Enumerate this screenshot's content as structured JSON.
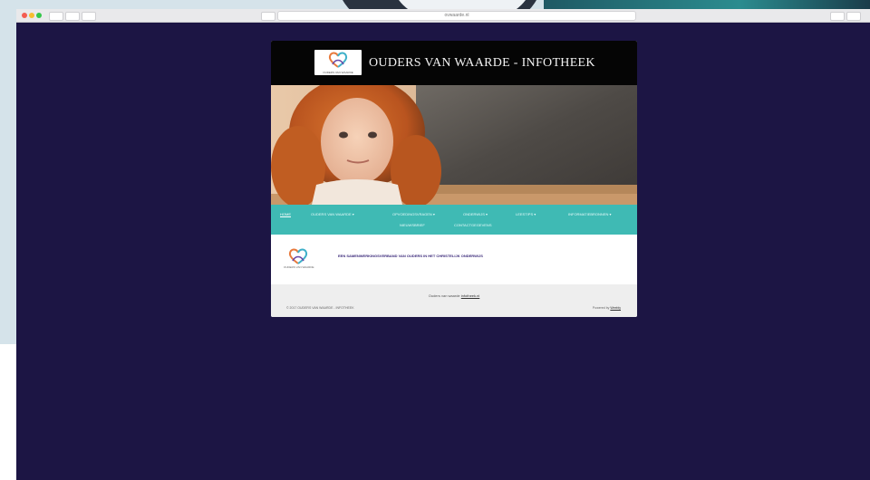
{
  "browser": {
    "url": "ovwaarde.nl"
  },
  "site": {
    "title": "OUDERS VAN WAARDE - INFOTHEEK",
    "logo_caption": "OUDERS VAN WAARDE",
    "nav": [
      {
        "label": "HOME",
        "active": true
      },
      {
        "label": "OUDERS VAN WAARDE ▾"
      },
      {
        "label": "OPVOEDINGSVRAGEN ▾"
      },
      {
        "label": "ONDERWIJS ▾"
      },
      {
        "label": "LEESTIPS ▾"
      },
      {
        "label": "INFORMATIEBRONNEN ▾"
      },
      {
        "label": "NIEUWSBRIEF"
      },
      {
        "label": "CONTACTGEGEVENS"
      }
    ],
    "content_text": "EEN SAMENWERKINGSVERBAND VAN OUDERS IN HET CHRISTELIJK ONDERWIJS",
    "footer": {
      "center_prefix": "Ouders van waarde",
      "center_link": "infotheek.nl",
      "left": "© 2017 OUDERS VAN WAARDE - INFOTHEEK",
      "right_prefix": "Powered by",
      "right_link": "Weebly"
    }
  },
  "colors": {
    "viewport_bg": "#1c1544",
    "nav_bg": "#3fbab4",
    "header_bg": "#050505",
    "content_text": "#3b2a7a"
  }
}
